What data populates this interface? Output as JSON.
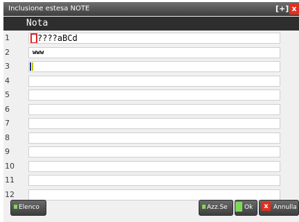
{
  "window": {
    "title": "Inclusione estesa NOTE",
    "restore_glyph": "[+]",
    "close_glyph": "x"
  },
  "table": {
    "column_header": "Nota",
    "rows": [
      {
        "num": "1",
        "text": "????aBCd"
      },
      {
        "num": "2",
        "text": "www"
      },
      {
        "num": "3",
        "text": ""
      },
      {
        "num": "4",
        "text": ""
      },
      {
        "num": "5",
        "text": ""
      },
      {
        "num": "6",
        "text": ""
      },
      {
        "num": "7",
        "text": ""
      },
      {
        "num": "8",
        "text": ""
      },
      {
        "num": "9",
        "text": ""
      },
      {
        "num": "10",
        "text": ""
      },
      {
        "num": "11",
        "text": ""
      },
      {
        "num": "12",
        "text": ""
      }
    ]
  },
  "buttons": {
    "elenco": "Elenco",
    "azz": "Azz.Se",
    "ok": "Ok",
    "annulla": "Annulla",
    "annulla_icon": "x"
  },
  "icons": {
    "elenco_icon": "green-square-icon",
    "azz_icon": "green-square-icon",
    "ok_icon": "green-square-icon",
    "annulla_icon": "red-x-icon"
  },
  "colors": {
    "title_bar": "#4a4a4a",
    "close_button": "#e03020",
    "accent_green": "#7ed957",
    "marker_red": "#e02020"
  }
}
